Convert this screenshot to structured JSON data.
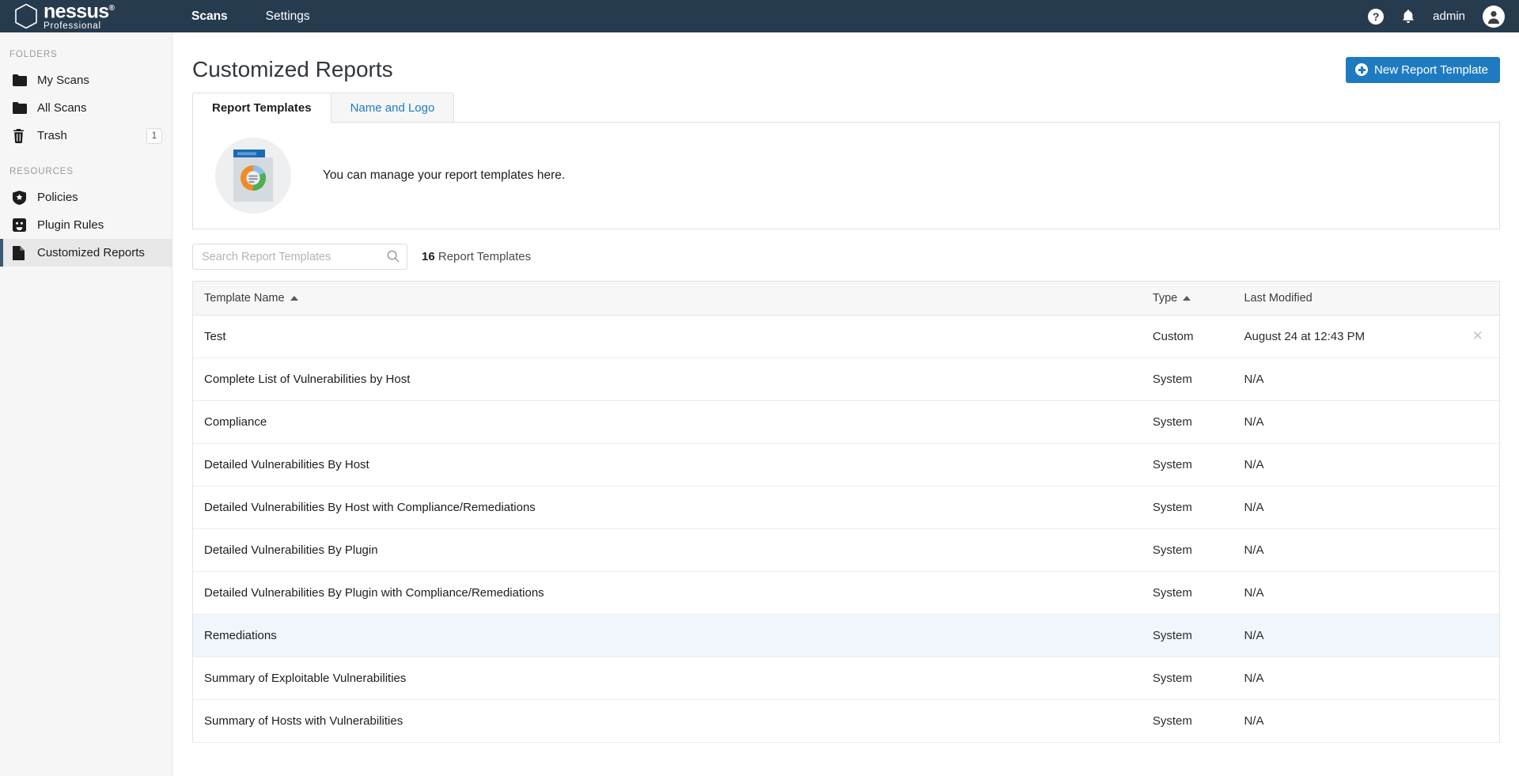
{
  "topbar": {
    "brand_name": "nessus",
    "brand_trademark": "®",
    "brand_sub": "Professional",
    "nav": [
      {
        "label": "Scans",
        "active": true
      },
      {
        "label": "Settings",
        "active": false
      }
    ],
    "help_icon": "question-mark-icon",
    "bell_icon": "notification-bell-icon",
    "user_label": "admin",
    "avatar_icon": "user-avatar-icon"
  },
  "sidebar": {
    "folders_title": "FOLDERS",
    "resources_title": "RESOURCES",
    "folders": [
      {
        "label": "My Scans",
        "icon": "folder-icon",
        "badge": null,
        "active": false
      },
      {
        "label": "All Scans",
        "icon": "folder-icon",
        "badge": null,
        "active": false
      },
      {
        "label": "Trash",
        "icon": "trash-icon",
        "badge": "1",
        "active": false
      }
    ],
    "resources": [
      {
        "label": "Policies",
        "icon": "shield-star-icon",
        "badge": null,
        "active": false
      },
      {
        "label": "Plugin Rules",
        "icon": "plugin-outlet-icon",
        "badge": null,
        "active": false
      },
      {
        "label": "Customized Reports",
        "icon": "document-icon",
        "badge": null,
        "active": true
      }
    ]
  },
  "page": {
    "title": "Customized Reports",
    "new_template_button": "New Report Template",
    "new_template_icon": "plus-circle-icon"
  },
  "tabs": [
    {
      "label": "Report Templates",
      "active": true
    },
    {
      "label": "Name and Logo",
      "active": false
    }
  ],
  "info": {
    "icon": "report-document-chart-icon",
    "text": "You can manage your report templates here."
  },
  "search": {
    "placeholder": "Search Report Templates",
    "value": "",
    "icon": "search-icon",
    "count_number": "16",
    "count_label": "Report Templates"
  },
  "table": {
    "columns": [
      {
        "label": "Template Name",
        "sort": "asc"
      },
      {
        "label": "Type",
        "sort": "asc"
      },
      {
        "label": "Last Modified",
        "sort": null
      },
      {
        "label": "",
        "sort": null
      }
    ],
    "rows": [
      {
        "name": "Test",
        "type": "Custom",
        "modified": "August 24 at 12:43 PM",
        "deletable": true,
        "highlight": false
      },
      {
        "name": "Complete List of Vulnerabilities by Host",
        "type": "System",
        "modified": "N/A",
        "deletable": false,
        "highlight": false
      },
      {
        "name": "Compliance",
        "type": "System",
        "modified": "N/A",
        "deletable": false,
        "highlight": false
      },
      {
        "name": "Detailed Vulnerabilities By Host",
        "type": "System",
        "modified": "N/A",
        "deletable": false,
        "highlight": false
      },
      {
        "name": "Detailed Vulnerabilities By Host with Compliance/Remediations",
        "type": "System",
        "modified": "N/A",
        "deletable": false,
        "highlight": false
      },
      {
        "name": "Detailed Vulnerabilities By Plugin",
        "type": "System",
        "modified": "N/A",
        "deletable": false,
        "highlight": false
      },
      {
        "name": "Detailed Vulnerabilities By Plugin with Compliance/Remediations",
        "type": "System",
        "modified": "N/A",
        "deletable": false,
        "highlight": false
      },
      {
        "name": "Remediations",
        "type": "System",
        "modified": "N/A",
        "deletable": false,
        "highlight": true
      },
      {
        "name": "Summary of Exploitable Vulnerabilities",
        "type": "System",
        "modified": "N/A",
        "deletable": false,
        "highlight": false
      },
      {
        "name": "Summary of Hosts with Vulnerabilities",
        "type": "System",
        "modified": "N/A",
        "deletable": false,
        "highlight": false
      }
    ],
    "delete_icon": "close-x-icon"
  },
  "colors": {
    "topbar_bg": "#273b4f",
    "accent_blue": "#1f7bc1",
    "sidebar_bg": "#f6f6f6",
    "row_highlight": "#f0f6fc"
  }
}
